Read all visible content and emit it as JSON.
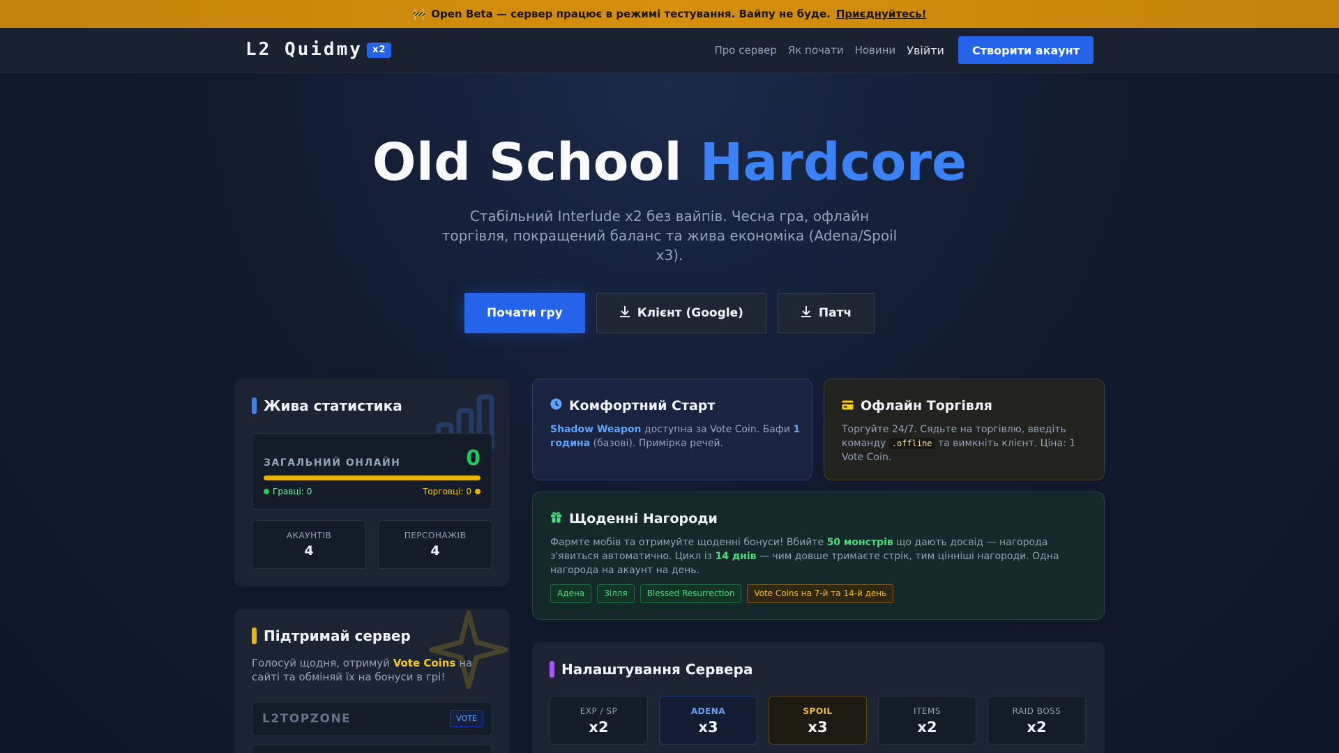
{
  "banner": {
    "icon": "🚧",
    "text": "Open Beta — сервер працює в режимі тестування. Вайпу не буде.",
    "link": "Приєднуйтесь!"
  },
  "nav": {
    "logo": "L2 Quidmy",
    "badge": "x2",
    "links": [
      "Про сервер",
      "Як почати",
      "Новини"
    ],
    "login": "Увійти",
    "cta": "Створити акаунт"
  },
  "hero": {
    "title_main": "Old School",
    "title_accent": "Hardcore",
    "subtitle": "Стабільний Interlude x2 без вайпів. Чесна гра, офлайн торгівля, покращений баланс та жива економіка (Adena/Spoil x3).",
    "btn_play": "Почати гру",
    "btn_client": "Клієнт (Google)",
    "btn_patch": "Патч"
  },
  "stats": {
    "title": "Жива статистика",
    "online_label": "ЗАГАЛЬНИЙ ОНЛАЙН",
    "online_value": "0",
    "online_fill_percent": 100,
    "players": "Гравці: 0",
    "traders": "Торговці: 0",
    "accounts_label": "АКАУНТІВ",
    "accounts_value": "4",
    "chars_label": "ПЕРСОНАЖІВ",
    "chars_value": "4"
  },
  "support": {
    "title": "Підтримай сервер",
    "text_before": "Голосуй щодня, отримуй",
    "text_hl": "Vote Coins",
    "text_after": "на сайті та обміняй їх на бонуси в грі!",
    "vote_site": "L2TOPZONE",
    "vote_tag": "VOTE"
  },
  "start": {
    "title": "Комфортний Старт",
    "hl1": "Shadow Weapon",
    "t1": "доступна за Vote Coin. Бафи",
    "hl2": "1 година",
    "t2": "(базові). Примірка речей."
  },
  "offline": {
    "title": "Офлайн Торгівля",
    "t1": "Торгуйте 24/7. Сядьте на торгівлю, введіть команду",
    "code": ".offline",
    "t2": "та вимкніть клієнт. Ціна: 1 Vote Coin."
  },
  "rewards": {
    "title": "Щоденні Нагороди",
    "t1": "Фармте мобів та отримуйте щоденні бонуси! Вбийте",
    "hl1": "50 монстрів",
    "t2": "що дають досвід — нагорода з'явиться автоматично. Цикл із",
    "hl2": "14 днів",
    "t3": "— чим довше тримаєте стрік, тим цінніші нагороди. Одна нагорода на акаунт на день.",
    "tags": [
      "Адена",
      "Зілля",
      "Blessed Resurrection"
    ],
    "tag_special": "Vote Coins на 7-й та 14-й день"
  },
  "settings": {
    "title": "Налаштування Сервера",
    "rates": [
      {
        "label": "EXP / SP",
        "value": "x2"
      },
      {
        "label": "ADENA",
        "value": "x3"
      },
      {
        "label": "SPOIL",
        "value": "x3"
      },
      {
        "label": "ITEMS",
        "value": "x2"
      },
      {
        "label": "RAID BOSS",
        "value": "x2"
      }
    ]
  },
  "colors": {
    "accent": "#2563eb",
    "banner": "#d68f0e",
    "online": "#22c55e",
    "traders": "#eab308"
  }
}
